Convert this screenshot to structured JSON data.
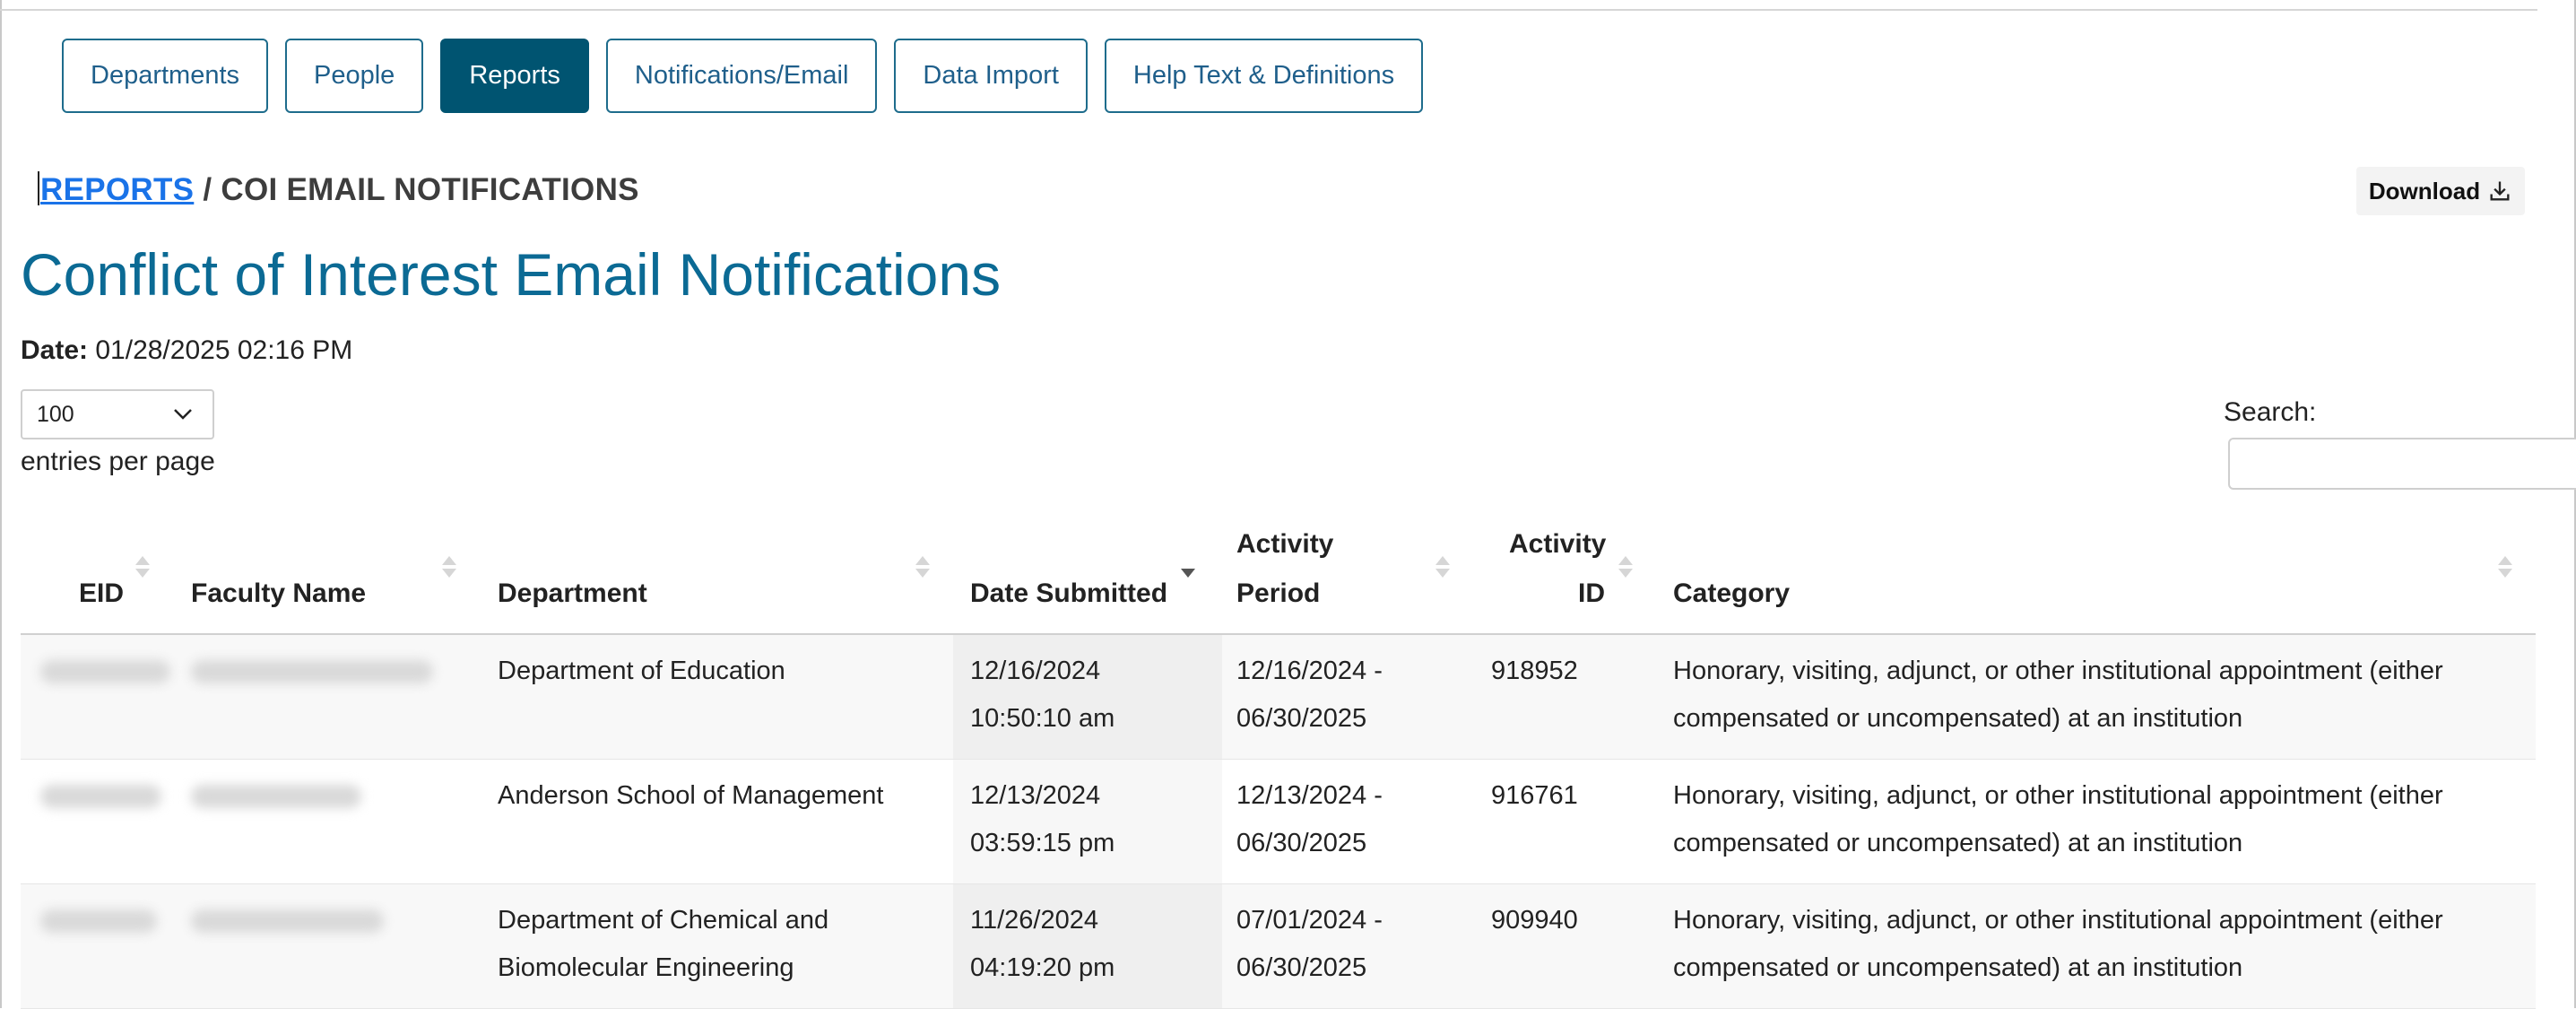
{
  "nav": [
    {
      "label": "Departments",
      "active": false
    },
    {
      "label": "People",
      "active": false
    },
    {
      "label": "Reports",
      "active": true
    },
    {
      "label": "Notifications/Email",
      "active": false
    },
    {
      "label": "Data Import",
      "active": false
    },
    {
      "label": "Help Text & Definitions",
      "active": false
    }
  ],
  "breadcrumb": {
    "link": "REPORTS",
    "separator": " / ",
    "current": "COI EMAIL NOTIFICATIONS"
  },
  "download_label": "Download",
  "title": "Conflict of Interest Email Notifications",
  "date": {
    "label": "Date:",
    "value": "01/28/2025 02:16 PM"
  },
  "entries": {
    "selected": "100",
    "label": "entries per page"
  },
  "search": {
    "label": "Search:",
    "value": ""
  },
  "table": {
    "columns": {
      "eid": "EID",
      "faculty_name": "Faculty Name",
      "department": "Department",
      "date_submitted": "Date Submitted",
      "activity_period_1": "Activity",
      "activity_period_2": "Period",
      "activity_id_1": "Activity",
      "activity_id_2": "ID",
      "category": "Category"
    },
    "rows": [
      {
        "department": [
          "Department of Education"
        ],
        "date_submitted": [
          "12/16/2024",
          "10:50:10 am"
        ],
        "activity_period": [
          "12/16/2024 -",
          "06/30/2025"
        ],
        "activity_id": "918952",
        "category": [
          "Honorary, visiting, adjunct, or other institutional appointment (either",
          "compensated or uncompensated) at an institution"
        ]
      },
      {
        "department": [
          "Anderson School of Management"
        ],
        "date_submitted": [
          "12/13/2024",
          "03:59:15 pm"
        ],
        "activity_period": [
          "12/13/2024 -",
          "06/30/2025"
        ],
        "activity_id": "916761",
        "category": [
          "Honorary, visiting, adjunct, or other institutional appointment (either",
          "compensated or uncompensated) at an institution"
        ]
      },
      {
        "department": [
          "Department of Chemical and",
          "Biomolecular Engineering"
        ],
        "date_submitted": [
          "11/26/2024",
          "04:19:20 pm"
        ],
        "activity_period": [
          "07/01/2024 -",
          "06/30/2025"
        ],
        "activity_id": "909940",
        "category": [
          "Honorary, visiting, adjunct, or other institutional appointment (either",
          "compensated or uncompensated) at an institution"
        ]
      }
    ]
  }
}
